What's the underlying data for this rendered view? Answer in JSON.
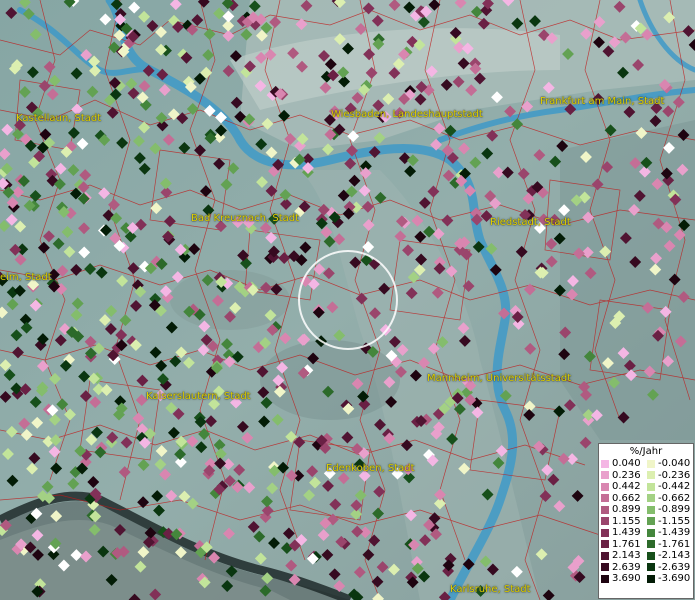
{
  "labels": [
    {
      "name": "kastellaun",
      "text": "Kastellaun, Stadt"
    },
    {
      "name": "wiesbaden",
      "text": "Wiesbaden, Landeshauptstadt"
    },
    {
      "name": "frankfurt",
      "text": "Frankfurt am Main, Stadt"
    },
    {
      "name": "bad-kreuznach",
      "text": "Bad Kreuznach, Stadt"
    },
    {
      "name": "riedstadt",
      "text": "Riedstadt, Stadt"
    },
    {
      "name": "left-edge",
      "text": "eim, Stadt"
    },
    {
      "name": "kaiserslautern",
      "text": "Kaiserslautern, Stadt"
    },
    {
      "name": "mannheim",
      "text": "Mannheim, Universitätsstadt"
    },
    {
      "name": "edenkoben",
      "text": "Edenkoben, Stadt"
    },
    {
      "name": "karlsruhe",
      "text": "Karlsruhe, Stadt"
    }
  ],
  "legend": {
    "title": "%/Jahr",
    "rows": [
      {
        "pos": "0.040",
        "pos_color": "#f4b6e4",
        "neg": "-0.040",
        "neg_color": "#f0f5c8"
      },
      {
        "pos": "0.236",
        "pos_color": "#e9a0cc",
        "neg": "-0.236",
        "neg_color": "#dcefb0"
      },
      {
        "pos": "0.442",
        "pos_color": "#d986b0",
        "neg": "-0.442",
        "neg_color": "#c2e49a"
      },
      {
        "pos": "0.662",
        "pos_color": "#c46e96",
        "neg": "-0.662",
        "neg_color": "#a3d184"
      },
      {
        "pos": "0.899",
        "pos_color": "#b05a80",
        "neg": "-0.899",
        "neg_color": "#84bd6c"
      },
      {
        "pos": "1.155",
        "pos_color": "#9a456c",
        "neg": "-1.155",
        "neg_color": "#63a253"
      },
      {
        "pos": "1.439",
        "pos_color": "#823158",
        "neg": "-1.439",
        "neg_color": "#44863c"
      },
      {
        "pos": "1.761",
        "pos_color": "#6a2044",
        "neg": "-1.761",
        "neg_color": "#2c6a2a"
      },
      {
        "pos": "2.143",
        "pos_color": "#501432",
        "neg": "-2.143",
        "neg_color": "#17501b"
      },
      {
        "pos": "2.639",
        "pos_color": "#360a20",
        "neg": "-2.639",
        "neg_color": "#0a3610"
      },
      {
        "pos": "3.690",
        "pos_color": "#1e0410",
        "neg": "-3.690",
        "neg_color": "#031c06"
      }
    ]
  }
}
